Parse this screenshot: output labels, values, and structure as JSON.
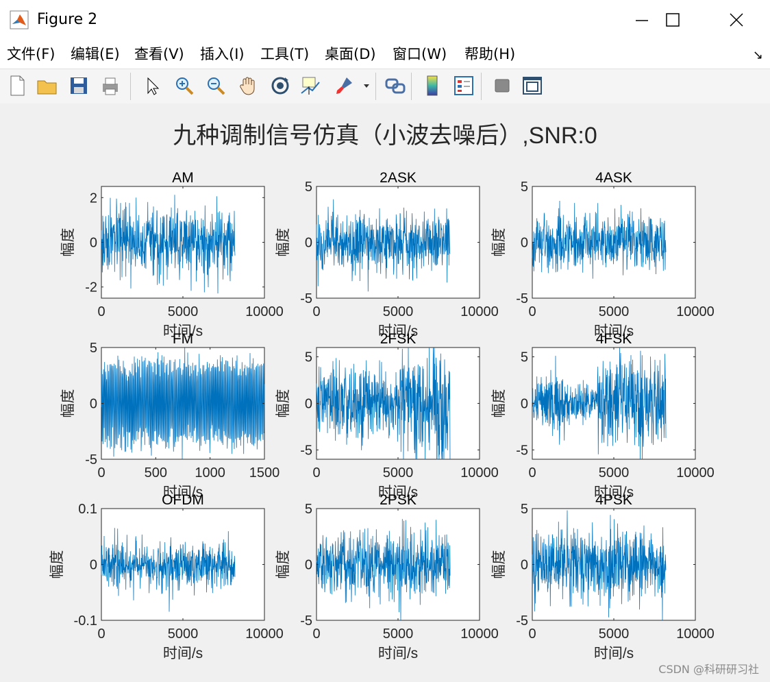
{
  "window": {
    "title": "Figure 2",
    "menu": [
      "文件(F)",
      "编辑(E)",
      "查看(V)",
      "插入(I)",
      "工具(T)",
      "桌面(D)",
      "窗口(W)",
      "帮助(H)"
    ]
  },
  "toolbar_icons": [
    "new-file-icon",
    "open-folder-icon",
    "save-icon",
    "print-icon",
    "pointer-icon",
    "zoom-in-icon",
    "zoom-out-icon",
    "pan-hand-icon",
    "rotate-3d-icon",
    "data-cursor-icon",
    "brush-icon",
    "link-plot-icon",
    "colorbar-icon",
    "legend-icon",
    "hide-plot-tools-icon",
    "show-plot-tools-icon"
  ],
  "figure": {
    "suptitle": "九种调制信号仿真（小波去噪后）,SNR:0"
  },
  "colors": {
    "signal": "#0072bd",
    "axes_bg": "#ffffff",
    "figure_bg": "#f0f0f0"
  },
  "chart_data": [
    {
      "type": "line",
      "title": "AM",
      "xlabel": "时间/s",
      "ylabel": "幅度",
      "xlim": [
        0,
        10000
      ],
      "ylim": [
        -2.5,
        2.5
      ],
      "xticks": [
        "0",
        "5000",
        "10000"
      ],
      "yticks": [
        "-2",
        "0",
        "2"
      ],
      "signal_x_end": 8192,
      "amplitude": 2.2
    },
    {
      "type": "line",
      "title": "2ASK",
      "xlabel": "时间/s",
      "ylabel": "幅度",
      "xlim": [
        0,
        10000
      ],
      "ylim": [
        -5,
        5
      ],
      "xticks": [
        "0",
        "5000",
        "10000"
      ],
      "yticks": [
        "-5",
        "0",
        "5"
      ],
      "signal_x_end": 8192,
      "amplitude": 3.9
    },
    {
      "type": "line",
      "title": "4ASK",
      "xlabel": "时间/s",
      "ylabel": "幅度",
      "xlim": [
        0,
        10000
      ],
      "ylim": [
        -5,
        5
      ],
      "xticks": [
        "0",
        "5000",
        "10000"
      ],
      "yticks": [
        "-5",
        "0",
        "5"
      ],
      "signal_x_end": 8192,
      "amplitude": 3.9
    },
    {
      "type": "line",
      "title": "FM",
      "xlabel": "时间/s",
      "ylabel": "幅度",
      "xlim": [
        0,
        1500
      ],
      "ylim": [
        -5,
        5
      ],
      "xticks": [
        "0",
        "500",
        "1000",
        "1500"
      ],
      "yticks": [
        "-5",
        "0",
        "5"
      ],
      "signal_x_end": 1500,
      "amplitude": 4.7
    },
    {
      "type": "line",
      "title": "2FSK",
      "xlabel": "时间/s",
      "ylabel": "幅度",
      "xlim": [
        0,
        10000
      ],
      "ylim": [
        -6,
        6
      ],
      "xticks": [
        "0",
        "5000",
        "10000"
      ],
      "yticks": [
        "-5",
        "0",
        "5"
      ],
      "signal_x_end": 8192,
      "amplitude": 5.9
    },
    {
      "type": "line",
      "title": "4FSK",
      "xlabel": "时间/s",
      "ylabel": "幅度",
      "xlim": [
        0,
        10000
      ],
      "ylim": [
        -6,
        6
      ],
      "xticks": [
        "0",
        "5000",
        "10000"
      ],
      "yticks": [
        "-5",
        "0",
        "5"
      ],
      "signal_x_end": 8192,
      "amplitude": 5.9
    },
    {
      "type": "line",
      "title": "OFDM",
      "xlabel": "时间/s",
      "ylabel": "幅度",
      "xlim": [
        0,
        10000
      ],
      "ylim": [
        -0.1,
        0.1
      ],
      "xticks": [
        "0",
        "5000",
        "10000"
      ],
      "yticks": [
        "-0.1",
        "0",
        "0.1"
      ],
      "signal_x_end": 8192,
      "amplitude": 0.06
    },
    {
      "type": "line",
      "title": "2PSK",
      "xlabel": "时间/s",
      "ylabel": "幅度",
      "xlim": [
        0,
        10000
      ],
      "ylim": [
        -5,
        5
      ],
      "xticks": [
        "0",
        "5000",
        "10000"
      ],
      "yticks": [
        "-5",
        "0",
        "5"
      ],
      "signal_x_end": 8192,
      "amplitude": 4.1
    },
    {
      "type": "line",
      "title": "4PSK",
      "xlabel": "时间/s",
      "ylabel": "幅度",
      "xlim": [
        0,
        10000
      ],
      "ylim": [
        -5,
        5
      ],
      "xticks": [
        "0",
        "5000",
        "10000"
      ],
      "yticks": [
        "-5",
        "0",
        "5"
      ],
      "signal_x_end": 8192,
      "amplitude": 4.6
    }
  ],
  "watermark": "CSDN @科研研习社"
}
